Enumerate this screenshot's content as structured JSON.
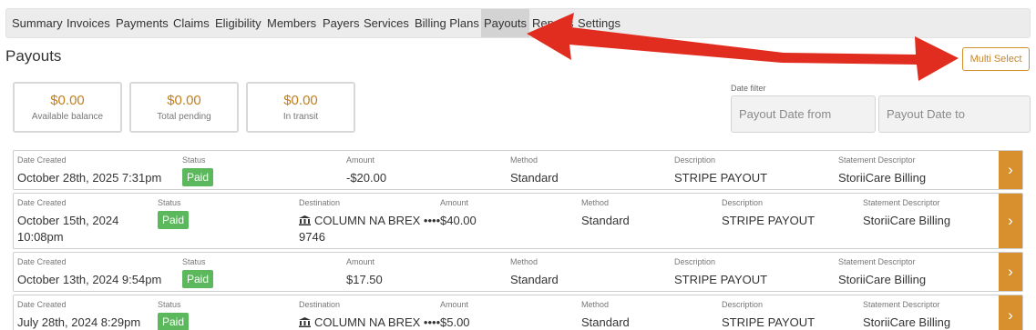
{
  "nav": {
    "tabs": [
      {
        "label": "Summary"
      },
      {
        "label": "Invoices"
      },
      {
        "label": "Payments"
      },
      {
        "label": "Claims"
      },
      {
        "label": "Eligibility"
      },
      {
        "label": "Members"
      },
      {
        "label": "Payers"
      },
      {
        "label": "Services"
      },
      {
        "label": "Billing Plans"
      },
      {
        "label": "Payouts",
        "active": true
      },
      {
        "label": "Reports"
      },
      {
        "label": "Settings"
      }
    ]
  },
  "page": {
    "title": "Payouts",
    "multi_select_label": "Multi Select"
  },
  "balances": [
    {
      "value": "$0.00",
      "label": "Available balance"
    },
    {
      "value": "$0.00",
      "label": "Total pending"
    },
    {
      "value": "$0.00",
      "label": "In transit"
    }
  ],
  "date_filter": {
    "label": "Date filter",
    "from_placeholder": "Payout Date from",
    "to_placeholder": "Payout Date to"
  },
  "column_labels": {
    "date_created": "Date Created",
    "status": "Status",
    "destination": "Destination",
    "amount": "Amount",
    "method": "Method",
    "description": "Description",
    "statement_descriptor": "Statement Descriptor"
  },
  "payouts": [
    {
      "date": "October 28th, 2025 7:31pm",
      "status": "Paid",
      "amount": "-$20.00",
      "method": "Standard",
      "description": "STRIPE PAYOUT",
      "statement_descriptor": "StoriiCare Billing"
    },
    {
      "date_line1": "October 15th, 2024",
      "date_line2": "10:08pm",
      "status": "Paid",
      "destination_line1": "COLUMN NA BREX ••••",
      "destination_line2": "9746",
      "amount": "$40.00",
      "method": "Standard",
      "description": "STRIPE PAYOUT",
      "statement_descriptor": "StoriiCare Billing"
    },
    {
      "date": "October 13th, 2024 9:54pm",
      "status": "Paid",
      "amount": "$17.50",
      "method": "Standard",
      "description": "STRIPE PAYOUT",
      "statement_descriptor": "StoriiCare Billing"
    },
    {
      "date_line1": "July 28th, 2024 8:29pm",
      "status": "Paid",
      "destination_line1": "COLUMN NA BREX ••••",
      "amount": "$5.00",
      "method": "Standard",
      "description": "STRIPE PAYOUT",
      "statement_descriptor": "StoriiCare Billing"
    }
  ],
  "row_arrow_glyph": "›",
  "colors": {
    "accent": "#d8902f",
    "paid_badge": "#5cb85c",
    "annotation_arrow": "#e02d1f"
  }
}
